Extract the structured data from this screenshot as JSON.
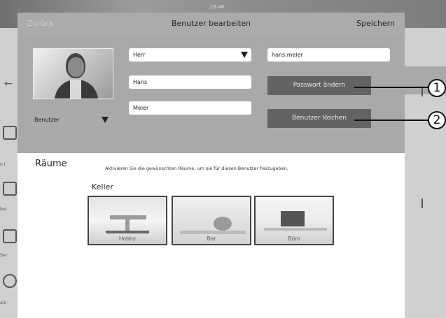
{
  "status_bar": {
    "time": "18:48"
  },
  "nav": {
    "back_label": "Zurück",
    "title": "Benutzer bearbeiten",
    "save_label": "Speichern"
  },
  "form": {
    "salutation": "Herr",
    "first_name": "Hans",
    "last_name": "Meier",
    "username": "hans.meier",
    "role": "Benutzer",
    "change_password_label": "Passwort ändern",
    "delete_user_label": "Benutzer löschen"
  },
  "callouts": [
    "1",
    "2"
  ],
  "rooms_section": {
    "hint": "Aktivieren Sie die gewünschten Räume, um sie für diesen Benutzer freizugeben.",
    "title": "Räume",
    "floor": "Keller",
    "rooms": [
      {
        "label": "Hobby"
      },
      {
        "label": "Bar"
      },
      {
        "label": "Büro"
      }
    ]
  },
  "background": {
    "left_labels": [
      "n I",
      "bur",
      "Ser",
      "alz"
    ]
  }
}
